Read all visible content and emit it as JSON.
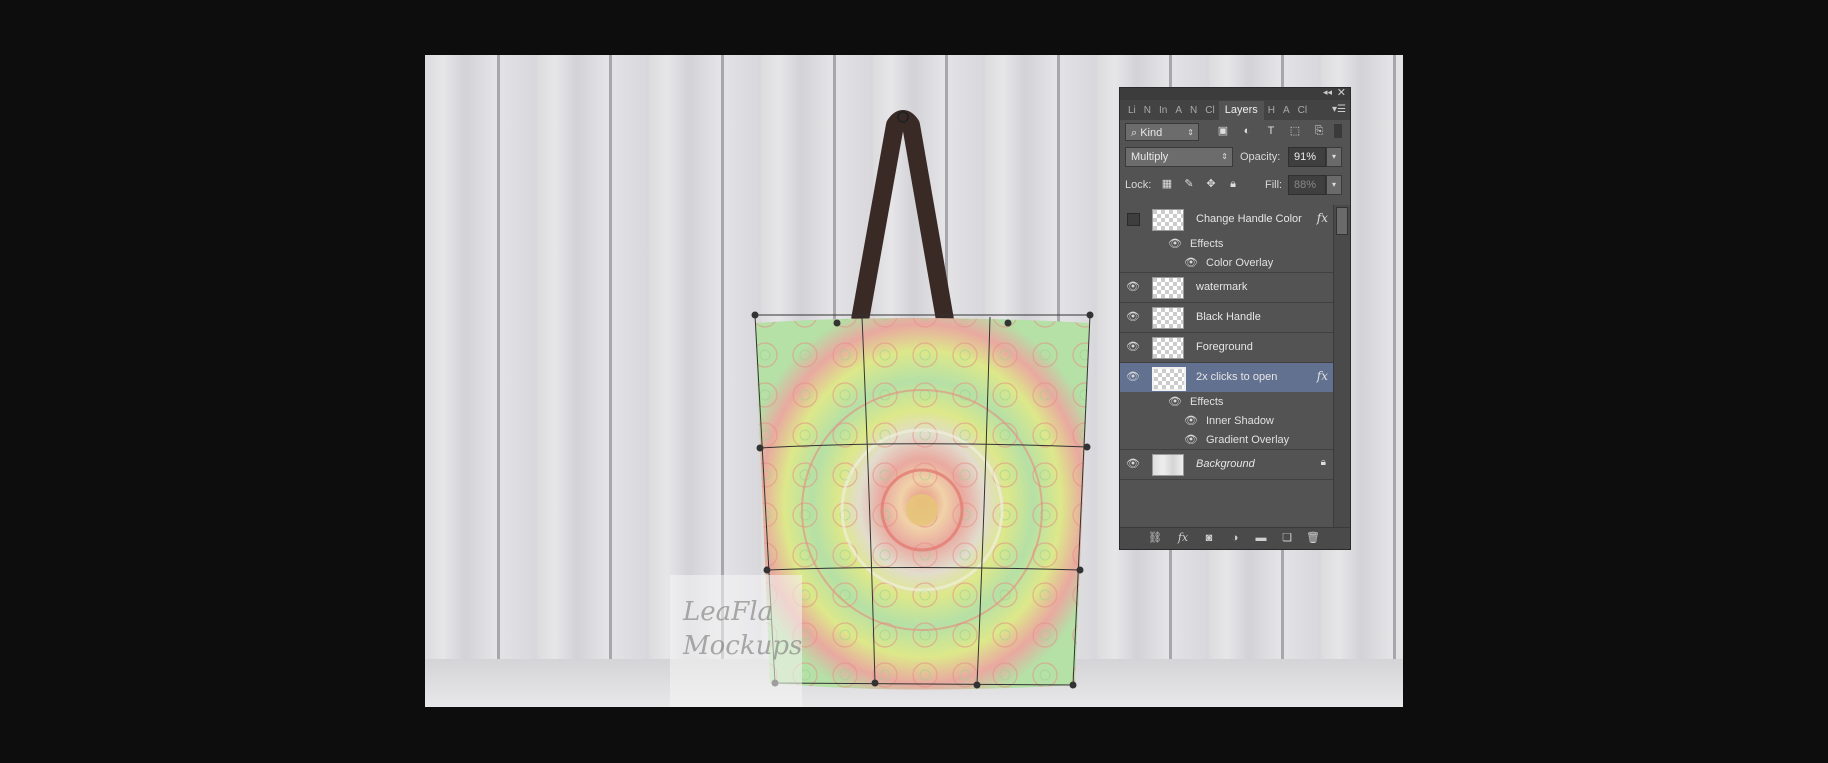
{
  "canvas": {
    "watermark_line1": "LeaFla",
    "watermark_line2": "Mockups"
  },
  "panel": {
    "tabs": [
      "Li",
      "N",
      "In",
      "A",
      "N",
      "Cl",
      "Layers",
      "H",
      "A",
      "Cl"
    ],
    "active_tab": "Layers",
    "filter_kind": "Kind",
    "blend_mode": "Multiply",
    "opacity_label": "Opacity:",
    "opacity_value": "91%",
    "lock_label": "Lock:",
    "fill_label": "Fill:",
    "fill_value": "88%",
    "layers": [
      {
        "name": "Change Handle Color",
        "visible": false,
        "fx": "fx"
      },
      {
        "name": "watermark",
        "visible": true
      },
      {
        "name": "Black Handle",
        "visible": true
      },
      {
        "name": "Foreground",
        "visible": true
      },
      {
        "name": "2x clicks to open",
        "visible": true,
        "selected": true,
        "fx": "fx"
      },
      {
        "name": "Background",
        "visible": true,
        "locked": true
      }
    ],
    "effects_label": "Effects",
    "effects_layer1": [
      "Color Overlay"
    ],
    "effects_layer5": [
      "Inner Shadow",
      "Gradient Overlay"
    ]
  },
  "colors": {
    "panel_bg": "#535353",
    "selected_layer": "#637190",
    "bag_green": "#b5e0a6",
    "bag_pink": "#e9a9a0",
    "bag_yellow": "#dde88a",
    "handle": "#3a2a26"
  },
  "icons": [
    "search-icon",
    "image-filter-icon",
    "adjustment-filter-icon",
    "type-filter-icon",
    "shape-filter-icon",
    "smartobject-filter-icon",
    "eye-icon",
    "lock-icon",
    "link-icon",
    "fx-icon",
    "mask-icon",
    "adjustment-icon",
    "folder-icon",
    "new-layer-icon",
    "trash-icon"
  ]
}
